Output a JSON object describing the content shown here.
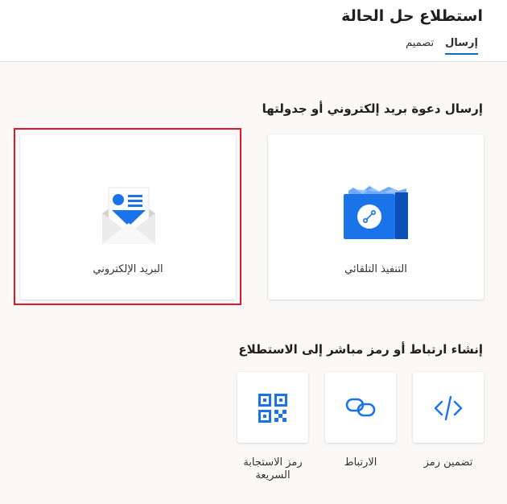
{
  "header": {
    "title": "استطلاع حل الحالة",
    "tabs": [
      {
        "label": "إرسال",
        "active": true
      },
      {
        "label": "تصميم",
        "active": false
      }
    ]
  },
  "email_section": {
    "title": "إرسال دعوة بريد إلكتروني أو جدولتها",
    "cards": [
      {
        "label": "التنفيذ التلقائي",
        "icon": "automation-icon"
      },
      {
        "label": "البريد الإلكتروني",
        "icon": "email-icon",
        "selected": true
      }
    ]
  },
  "link_section": {
    "title": "إنشاء ارتباط أو رمز مباشر إلى الاستطلاع",
    "cards": [
      {
        "label": "تضمين رمز",
        "icon": "embed-code-icon"
      },
      {
        "label": "الارتباط",
        "icon": "link-icon"
      },
      {
        "label": "رمز الاستجابة السريعة",
        "icon": "qr-code-icon"
      }
    ]
  },
  "colors": {
    "accent": "#0f6cbd",
    "icon_blue": "#1a73e8",
    "selection": "#e0162b"
  }
}
